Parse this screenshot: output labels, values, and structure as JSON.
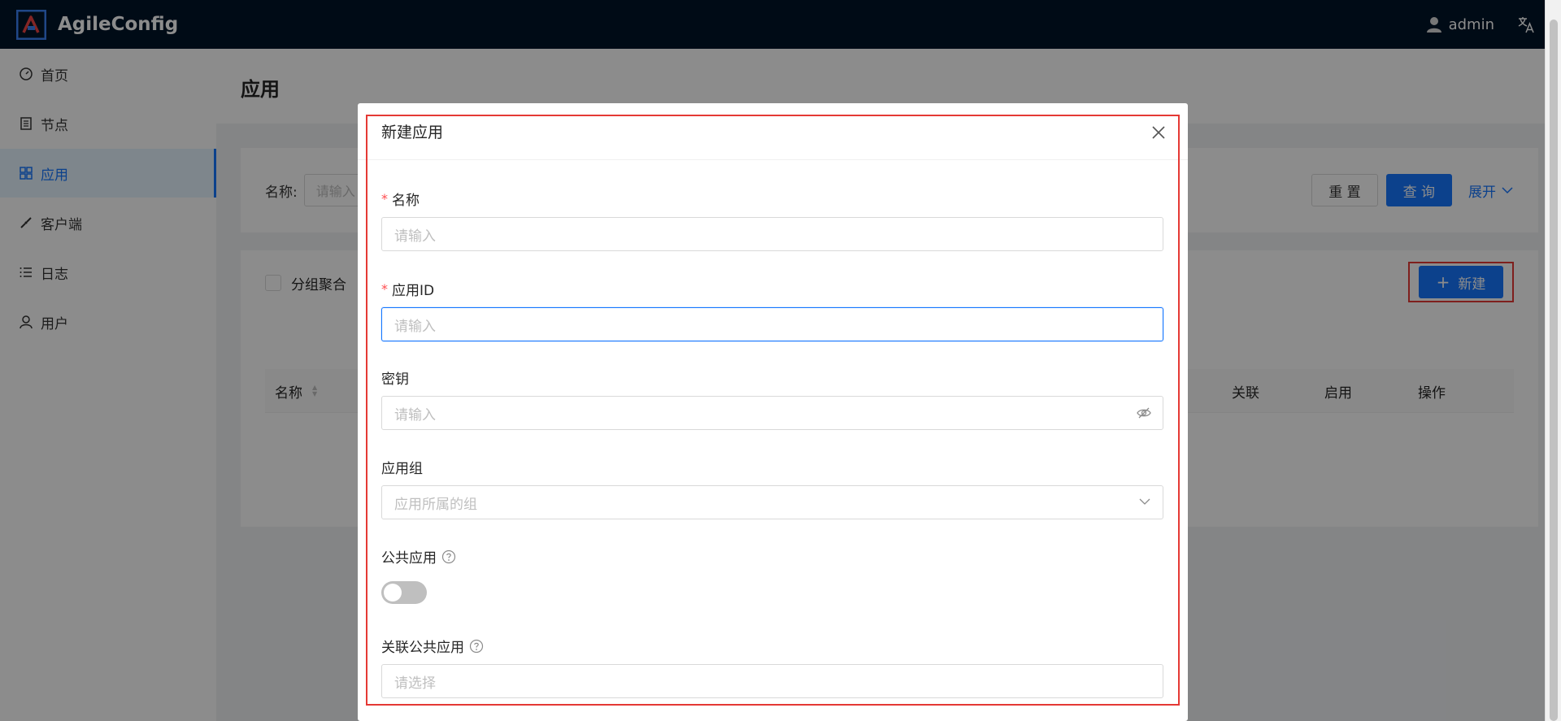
{
  "app": {
    "name": "AgileConfig",
    "accent": "#1677ff",
    "header_bg": "#001529"
  },
  "header": {
    "user_name": "admin",
    "user_icon": "user-icon",
    "language_icon": "translate-icon"
  },
  "sidebar": {
    "items": [
      {
        "label": "首页",
        "icon": "dashboard-icon",
        "active": false
      },
      {
        "label": "节点",
        "icon": "node-list-icon",
        "active": false
      },
      {
        "label": "应用",
        "icon": "appstore-icon",
        "active": true
      },
      {
        "label": "客户端",
        "icon": "client-icon",
        "active": false
      },
      {
        "label": "日志",
        "icon": "log-list-icon",
        "active": false
      },
      {
        "label": "用户",
        "icon": "user-icon",
        "active": false
      }
    ]
  },
  "page": {
    "title": "应用",
    "search": {
      "name_label": "名称:",
      "name_placeholder": "请输入",
      "reset_label": "重 置",
      "query_label": "查 询",
      "expand_label": "展开"
    },
    "table": {
      "group_checkbox_label": "分组聚合",
      "new_button_label": "新建",
      "columns": [
        "名称",
        "关联",
        "启用",
        "操作"
      ]
    }
  },
  "modal": {
    "title": "新建应用",
    "fields": {
      "name": {
        "label": "名称",
        "required": true,
        "placeholder": "请输入"
      },
      "app_id": {
        "label": "应用ID",
        "required": true,
        "placeholder": "请输入"
      },
      "secret": {
        "label": "密钥",
        "required": false,
        "placeholder": "请输入"
      },
      "group": {
        "label": "应用组",
        "required": false,
        "placeholder": "应用所属的组"
      },
      "public_app": {
        "label": "公共应用",
        "value": false
      },
      "linked_public_apps": {
        "label": "关联公共应用",
        "placeholder": "请选择"
      }
    }
  }
}
